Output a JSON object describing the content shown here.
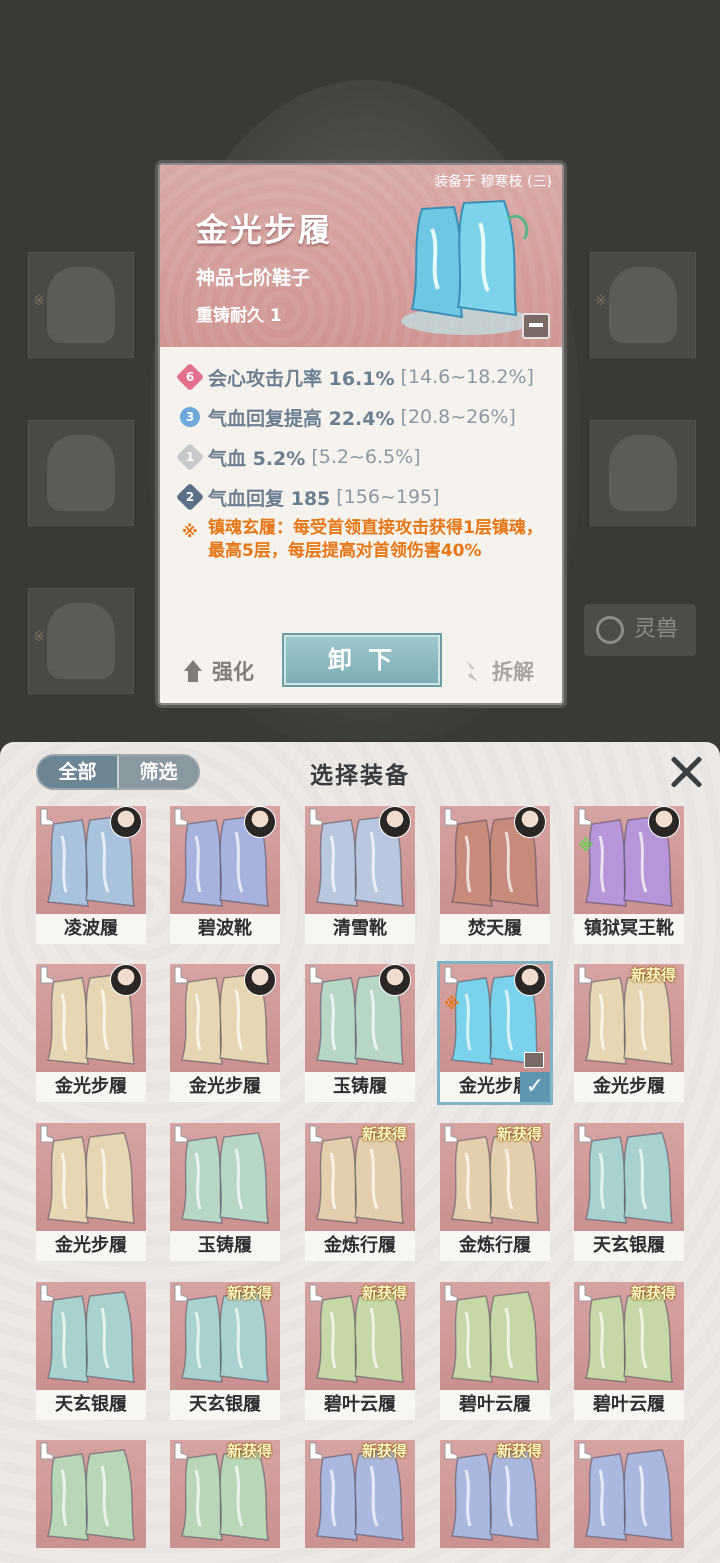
{
  "popup": {
    "equipped_text": "装备于 穆寒枝 (三)",
    "name": "金光步履",
    "grade": "神品七阶鞋子",
    "durability": "重铸耐久 1",
    "stats": [
      {
        "badge": "6",
        "badge_color": "#e46f8c",
        "main": "会心攻击几率 16.1%",
        "range": "[14.6~18.2%]"
      },
      {
        "badge": "3",
        "badge_color": "#6fa9d9",
        "main": "气血回复提高 22.4%",
        "range": "[20.8~26%]"
      },
      {
        "badge": "1",
        "badge_color": "#c9c9c9",
        "main": "气血 5.2%",
        "range": "[5.2~6.5%]"
      },
      {
        "badge": "2",
        "badge_color": "#5b6f86",
        "main": "气血回复 185",
        "range": "[156~195]"
      }
    ],
    "special_text": "镇魂玄履：每受首领直接攻击获得1层镇魂，最高5层，每层提高对首领伤害40%",
    "strengthen_label": "强化",
    "unequip_label": "卸 下",
    "dismantle_label": "拆解"
  },
  "background": {
    "lingshou_label": "灵兽"
  },
  "panel": {
    "tab_all": "全部",
    "tab_filter": "筛选",
    "title": "选择装备"
  },
  "items": [
    {
      "label": "凌波履",
      "color": "#a9c3dc",
      "avatar": true,
      "new": false,
      "mark": ""
    },
    {
      "label": "碧波靴",
      "color": "#a7b3de",
      "avatar": true,
      "new": false,
      "mark": ""
    },
    {
      "label": "清雪靴",
      "color": "#b9c7df",
      "avatar": true,
      "new": false,
      "mark": ""
    },
    {
      "label": "焚天履",
      "color": "#c78b7c",
      "avatar": true,
      "new": false,
      "mark": ""
    },
    {
      "label": "镇狱冥王靴",
      "color": "#b696d8",
      "avatar": true,
      "new": false,
      "mark": "green"
    },
    {
      "label": "金光步履",
      "color": "#e6d6b4",
      "avatar": true,
      "new": false,
      "mark": ""
    },
    {
      "label": "金光步履",
      "color": "#e6d6b4",
      "avatar": true,
      "new": false,
      "mark": ""
    },
    {
      "label": "玉铸履",
      "color": "#b8d6c4",
      "avatar": true,
      "new": false,
      "mark": ""
    },
    {
      "label": "金光步履",
      "color": "#7ad3ea",
      "avatar": true,
      "new": false,
      "mark": "orange",
      "selected": true
    },
    {
      "label": "金光步履",
      "color": "#e6d6b4",
      "avatar": false,
      "new": true,
      "mark": ""
    },
    {
      "label": "金光步履",
      "color": "#e6d6b4",
      "avatar": false,
      "new": false,
      "mark": ""
    },
    {
      "label": "玉铸履",
      "color": "#b8d6c4",
      "avatar": false,
      "new": false,
      "mark": ""
    },
    {
      "label": "金炼行履",
      "color": "#e3cfae",
      "avatar": false,
      "new": true,
      "mark": ""
    },
    {
      "label": "金炼行履",
      "color": "#e3cfae",
      "avatar": false,
      "new": true,
      "mark": ""
    },
    {
      "label": "天玄银履",
      "color": "#a9d1cf",
      "avatar": false,
      "new": false,
      "mark": ""
    },
    {
      "label": "天玄银履",
      "color": "#a9d1cf",
      "avatar": false,
      "new": false,
      "mark": ""
    },
    {
      "label": "天玄银履",
      "color": "#a9d1cf",
      "avatar": false,
      "new": true,
      "mark": ""
    },
    {
      "label": "碧叶云履",
      "color": "#c6d8a8",
      "avatar": false,
      "new": true,
      "mark": ""
    },
    {
      "label": "碧叶云履",
      "color": "#c6d8a8",
      "avatar": false,
      "new": false,
      "mark": ""
    },
    {
      "label": "碧叶云履",
      "color": "#c6d8a8",
      "avatar": false,
      "new": true,
      "mark": ""
    },
    {
      "label": "",
      "color": "#b9d6b9",
      "avatar": false,
      "new": false,
      "mark": ""
    },
    {
      "label": "",
      "color": "#b9d6b9",
      "avatar": false,
      "new": true,
      "mark": ""
    },
    {
      "label": "",
      "color": "#aab8e0",
      "avatar": false,
      "new": true,
      "mark": ""
    },
    {
      "label": "",
      "color": "#aab8e0",
      "avatar": false,
      "new": true,
      "mark": ""
    },
    {
      "label": "",
      "color": "#aab8e0",
      "avatar": false,
      "new": false,
      "mark": ""
    }
  ],
  "new_tag_text": "新获得"
}
